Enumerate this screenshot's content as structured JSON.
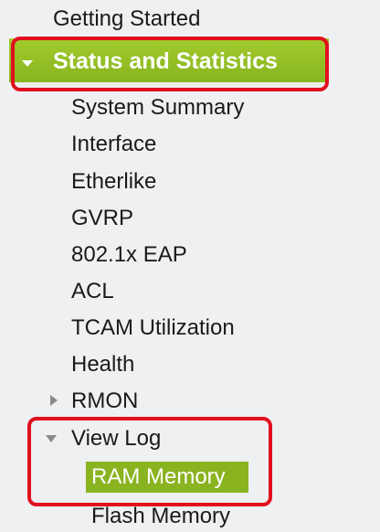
{
  "nav": {
    "top_item": "Getting Started",
    "section": "Status and Statistics",
    "items": [
      "System Summary",
      "Interface",
      "Etherlike",
      "GVRP",
      "802.1x EAP",
      "ACL",
      "TCAM Utilization",
      "Health",
      "RMON",
      "View Log"
    ],
    "view_log_children": {
      "selected": "RAM Memory",
      "other": "Flash Memory"
    }
  },
  "colors": {
    "section_bar": "#8ab320",
    "highlight": "#e0101e",
    "background": "#eef0f2"
  }
}
